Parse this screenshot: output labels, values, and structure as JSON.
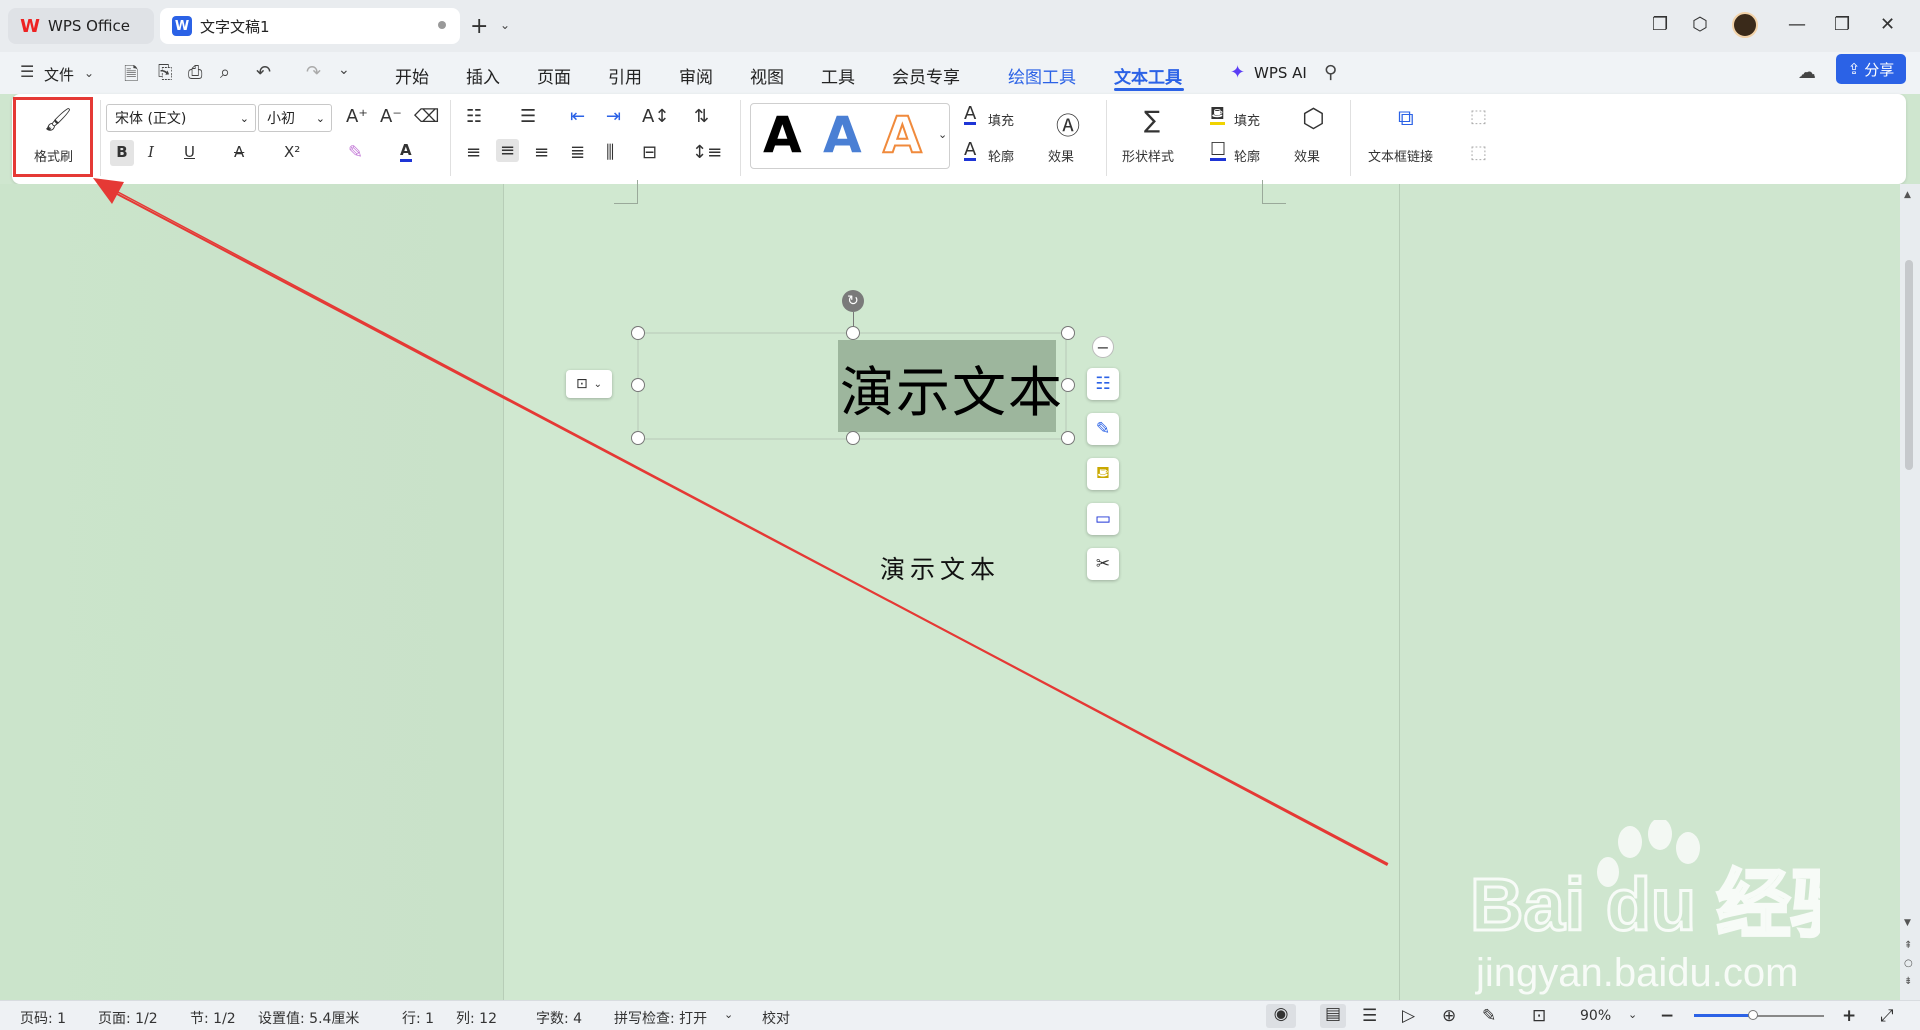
{
  "titlebar": {
    "app_tab": "WPS Office",
    "doc_tab": "文字文稿1",
    "new_tab_symbol": "+",
    "dropdown_symbol": "⌄"
  },
  "menubar": {
    "file": "文件",
    "items": [
      "开始",
      "插入",
      "页面",
      "引用",
      "审阅",
      "视图",
      "工具",
      "会员专享",
      "绘图工具",
      "文本工具"
    ],
    "active_item": "文本工具",
    "wps_ai": "WPS AI",
    "share": "分享"
  },
  "ribbon": {
    "format_painter": "格式刷",
    "font_name": "宋体 (正文)",
    "font_size": "小初",
    "bold": "B",
    "italic": "I",
    "underline": "U",
    "strike": "A",
    "superscript": "X²",
    "font_color": "A",
    "art_styles": [
      "A",
      "A",
      "A"
    ],
    "text_fill": "填充",
    "text_outline": "轮廓",
    "text_effect": "效果",
    "shape_style": "形状样式",
    "shape_fill": "填充",
    "shape_outline": "轮廓",
    "shape_effect": "效果",
    "textbox_link": "文本框链接"
  },
  "document": {
    "big_text": "演示文本",
    "small_text": "演示文本"
  },
  "statusbar": {
    "page_num": "页码: 1",
    "pages": "页面: 1/2",
    "section": "节: 1/2",
    "setting": "设置值: 5.4厘米",
    "row": "行: 1",
    "col": "列: 12",
    "word_count": "字数: 4",
    "spell_check": "拼写检查: 打开",
    "proofread": "校对",
    "zoom": "90%",
    "zoom_level": 0.45
  },
  "watermark": {
    "brand": "Bai du 经验",
    "url": "jingyan.baidu.com"
  },
  "colors": {
    "accent": "#2b62e6",
    "annotation_red": "#e53935",
    "canvas_green": "#cfe6cf"
  }
}
